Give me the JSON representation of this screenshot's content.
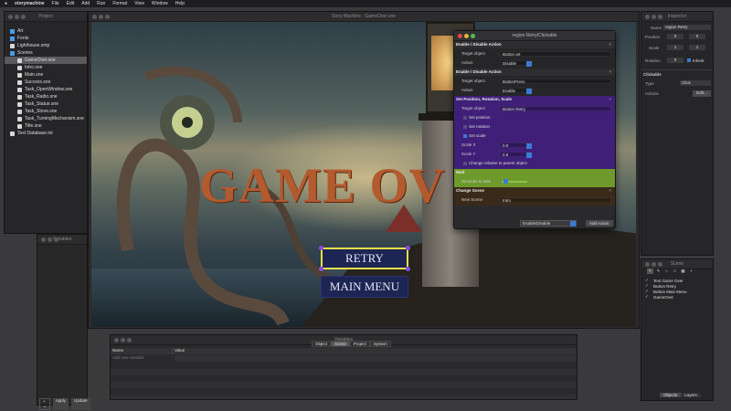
{
  "menubar": {
    "app": "storymachine",
    "items": [
      "File",
      "Edit",
      "Add",
      "Run",
      "Format",
      "View",
      "Window",
      "Help"
    ]
  },
  "project": {
    "title": "Project",
    "tree": [
      {
        "label": "Art",
        "kind": "folder",
        "depth": 0,
        "color": "#4a9be6"
      },
      {
        "label": "Fonts",
        "kind": "folder",
        "depth": 0,
        "color": "#4a9be6"
      },
      {
        "label": "Lighthouse.smp",
        "kind": "file",
        "depth": 0
      },
      {
        "label": "Scenes",
        "kind": "folder",
        "depth": 0,
        "color": "#4a9be6"
      },
      {
        "label": "GameOver.sne",
        "kind": "scene",
        "depth": 1,
        "selected": true
      },
      {
        "label": "Intro.sne",
        "kind": "scene",
        "depth": 1
      },
      {
        "label": "Main.sne",
        "kind": "scene",
        "depth": 1
      },
      {
        "label": "Success.sne",
        "kind": "scene",
        "depth": 1
      },
      {
        "label": "Task_OpenWindow.sne",
        "kind": "scene",
        "depth": 1
      },
      {
        "label": "Task_Radio.sne",
        "kind": "scene",
        "depth": 1
      },
      {
        "label": "Task_Statue.sne",
        "kind": "scene",
        "depth": 1
      },
      {
        "label": "Task_Stove.sne",
        "kind": "scene",
        "depth": 1
      },
      {
        "label": "Task_TurningMechanism.sne",
        "kind": "scene",
        "depth": 1
      },
      {
        "label": "Title.sne",
        "kind": "scene",
        "depth": 1
      },
      {
        "label": "Text Database.txt",
        "kind": "file",
        "depth": 0
      }
    ]
  },
  "scene_window": {
    "title": "Story Machine - GameOver.sne",
    "game_over": "GAME OV",
    "retry": "RETRY",
    "main_menu": "MAIN MENU"
  },
  "region": {
    "title": "region Retry/Clickable",
    "sections": [
      {
        "header": "Enable / Disable Action",
        "color": "#2c2c2e",
        "rows": [
          {
            "label": "Target object",
            "value": "Button art"
          },
          {
            "label": "Action",
            "value": "Disable",
            "kind": "select"
          }
        ]
      },
      {
        "header": "Enable / Disable Action",
        "color": "#2c2c2e",
        "rows": [
          {
            "label": "Target object",
            "value": "ButtonPress"
          },
          {
            "label": "Action",
            "value": "Enable",
            "kind": "select"
          }
        ]
      },
      {
        "header": "Set Position, Rotation, Scale",
        "color": "#3f1f78",
        "rows": [
          {
            "label": "Target object",
            "value": "Button Retry"
          },
          {
            "label": "Set position",
            "kind": "check",
            "checked": false
          },
          {
            "label": "Set rotation",
            "kind": "check",
            "checked": false
          },
          {
            "label": "Set scale",
            "kind": "check",
            "checked": true
          },
          {
            "label": "Scale X",
            "value": "0.9",
            "kind": "select"
          },
          {
            "label": "Scale Y",
            "value": "0.9",
            "kind": "select"
          },
          {
            "label": "Change relative to parent object",
            "kind": "check",
            "checked": false
          }
        ]
      },
      {
        "header": "Wait",
        "color": "#6e9a2c",
        "rows": [
          {
            "label": "Seconds to wait",
            "value": "",
            "kind": "slider",
            "level": 0.08
          }
        ]
      },
      {
        "header": "Change Scene",
        "color": "#3a2a1a",
        "rows": [
          {
            "label": "New Scene",
            "value": "Intro"
          }
        ]
      }
    ],
    "footer_select": "Enable/Disable",
    "add_action": "Add Action"
  },
  "inspector": {
    "title": "Inspector",
    "name_label": "Name",
    "name_value": "region Retry",
    "position_label": "Position",
    "pos_x": "0",
    "pos_y": "0",
    "scale_label": "Scale",
    "scale_x": "1",
    "scale_y": "1",
    "rotation_label": "Rotation",
    "rot_value": "0",
    "inherit_label": "Inherit",
    "clickable_header": "Clickable",
    "type_label": "Type",
    "type_value": "Click",
    "actions_label": "Actions",
    "edit_btn": "Edit..."
  },
  "objects": {
    "title": "Scene",
    "items": [
      "Text Game Over",
      "Button Retry",
      "Button Main Menu",
      "GameOver"
    ],
    "tabs": [
      "Objects",
      "Layers"
    ]
  },
  "variables_panel": {
    "title": "Variables",
    "apply": "Apply",
    "update": "Update"
  },
  "bottom": {
    "title": "Variables",
    "tabs": [
      "Object",
      "Scene",
      "Project",
      "System"
    ],
    "active_tab": 1,
    "cols": [
      "Name",
      "Value"
    ],
    "placeholder": "Add new variable"
  },
  "colors": {
    "accent": "#3a7bd5",
    "purple": "#3f1f78",
    "green": "#6e9a2c"
  }
}
